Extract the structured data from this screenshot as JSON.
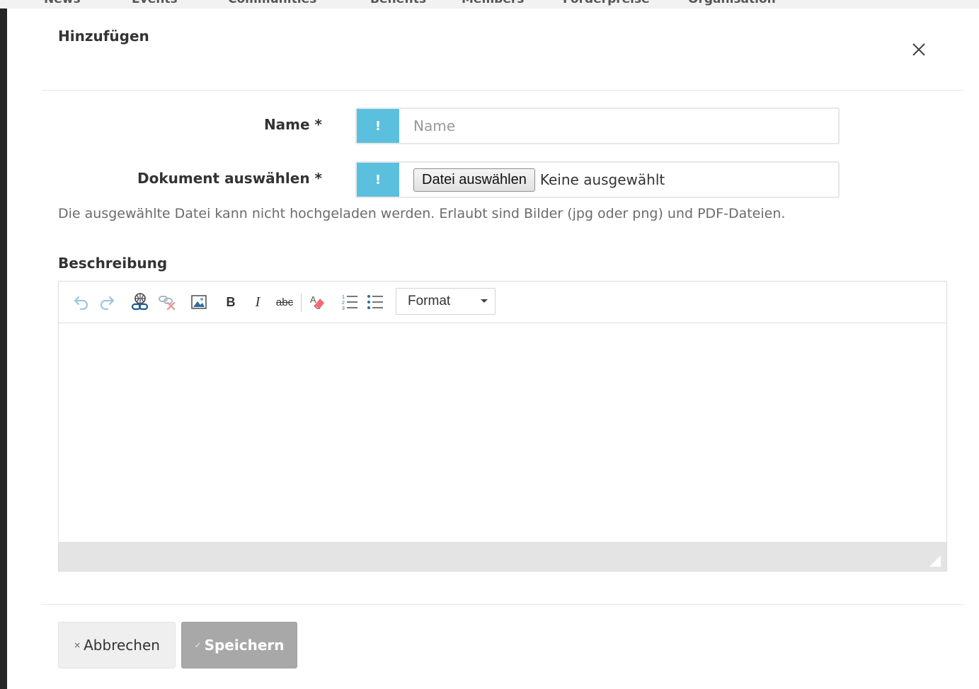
{
  "backdrop": {
    "nav_items": [
      "News",
      "Events",
      "Communities",
      "Benefits",
      "Members",
      "Förderpreise",
      "Organisation"
    ]
  },
  "modal": {
    "title": "Hinzufügen",
    "close_icon": "close-icon"
  },
  "form": {
    "name": {
      "label": "Name *",
      "addon": "!",
      "value": "",
      "placeholder": "Name"
    },
    "document": {
      "label": "Dokument auswählen *",
      "addon": "!",
      "button_label": "Datei auswählen",
      "status": "Keine ausgewählt"
    },
    "help_text": "Die ausgewählte Datei kann nicht hochgeladen werden. Erlaubt sind Bilder (jpg oder png) und PDF-Dateien.",
    "description": {
      "label": "Beschreibung",
      "toolbar": {
        "icons": [
          "undo-icon",
          "redo-icon",
          "link-icon",
          "unlink-icon",
          "image-icon",
          "bold-icon",
          "italic-icon",
          "strikethrough-icon",
          "remove-format-icon",
          "numbered-list-icon",
          "bulleted-list-icon"
        ],
        "bold": "B",
        "italic": "I",
        "strike": "abc",
        "format_label": "Format"
      },
      "content": ""
    }
  },
  "actions": {
    "cancel": {
      "icon": "×",
      "label": "Abbrechen"
    },
    "save": {
      "icon": "✓",
      "label": "Speichern"
    }
  },
  "colors": {
    "addon": "#5bc0de",
    "save_button": "#a8a8a8",
    "cancel_button": "#efefef"
  }
}
